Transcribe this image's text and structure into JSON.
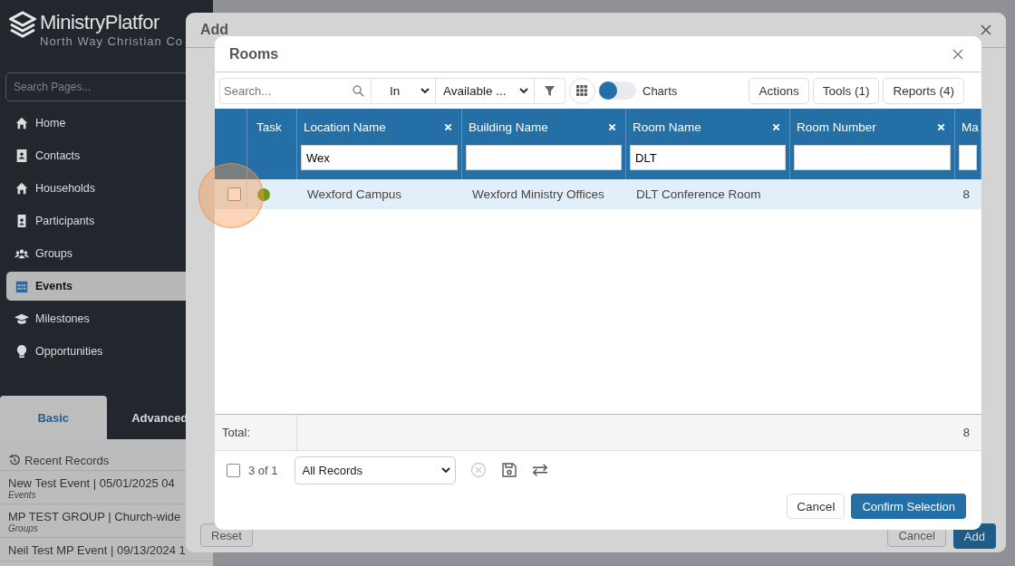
{
  "sidebar": {
    "brand": "MinistryPlatfor",
    "org": "North Way Christian Co",
    "search": {
      "placeholder": "Search Pages..."
    },
    "nav": [
      {
        "label": "Home",
        "kind": "home",
        "selected": false
      },
      {
        "label": "Contacts",
        "kind": "card",
        "selected": false
      },
      {
        "label": "Households",
        "kind": "home",
        "selected": false
      },
      {
        "label": "Participants",
        "kind": "badge",
        "selected": false
      },
      {
        "label": "Groups",
        "kind": "people",
        "selected": false
      },
      {
        "label": "Events",
        "kind": "calendar",
        "selected": true
      },
      {
        "label": "Milestones",
        "kind": "cap",
        "selected": false
      },
      {
        "label": "Opportunities",
        "kind": "bulb",
        "selected": false
      }
    ],
    "tabs": [
      {
        "label": "Basic",
        "selected": true
      },
      {
        "label": "Advanced",
        "selected": false
      }
    ],
    "recent": {
      "title": "Recent Records",
      "items": [
        {
          "title": "New Test Event | 05/01/2025 04",
          "subtitle": "Events"
        },
        {
          "title": "MP TEST GROUP | Church-wide",
          "subtitle": "Groups"
        },
        {
          "title": "Neil Test MP Event | 09/13/2024 1"
        }
      ]
    }
  },
  "add_dialog": {
    "title": "Add",
    "reset": "Reset",
    "cancel": "Cancel",
    "add": "Add"
  },
  "rooms_dialog": {
    "title": "Rooms",
    "toolbar": {
      "search": {
        "placeholder": "Search..."
      },
      "scope": "In",
      "view": "Available ...",
      "charts": {
        "label": "Charts",
        "on": false
      },
      "buttons": [
        "Actions",
        "Tools (1)",
        "Reports (4)"
      ]
    },
    "task_column": {
      "label": "Task"
    },
    "columns": [
      {
        "label": "Location Name",
        "filter": "Wex"
      },
      {
        "label": "Building Name"
      },
      {
        "label": "Room Name",
        "filter": "DLT"
      },
      {
        "label": "Room Number"
      },
      {
        "label": "Ma"
      }
    ],
    "rows": [
      {
        "checked": false,
        "color": "#6f9a1e",
        "cells": [
          "Wexford Campus",
          "Wexford Ministry Offices",
          "DLT Conference Room",
          "",
          "8"
        ]
      }
    ],
    "total": {
      "label": "Total:",
      "value": "8"
    },
    "footer": {
      "checked": false,
      "count": "3 of 1",
      "selection": "All Records",
      "cancel": "Cancel",
      "confirm": "Confirm Selection"
    }
  }
}
